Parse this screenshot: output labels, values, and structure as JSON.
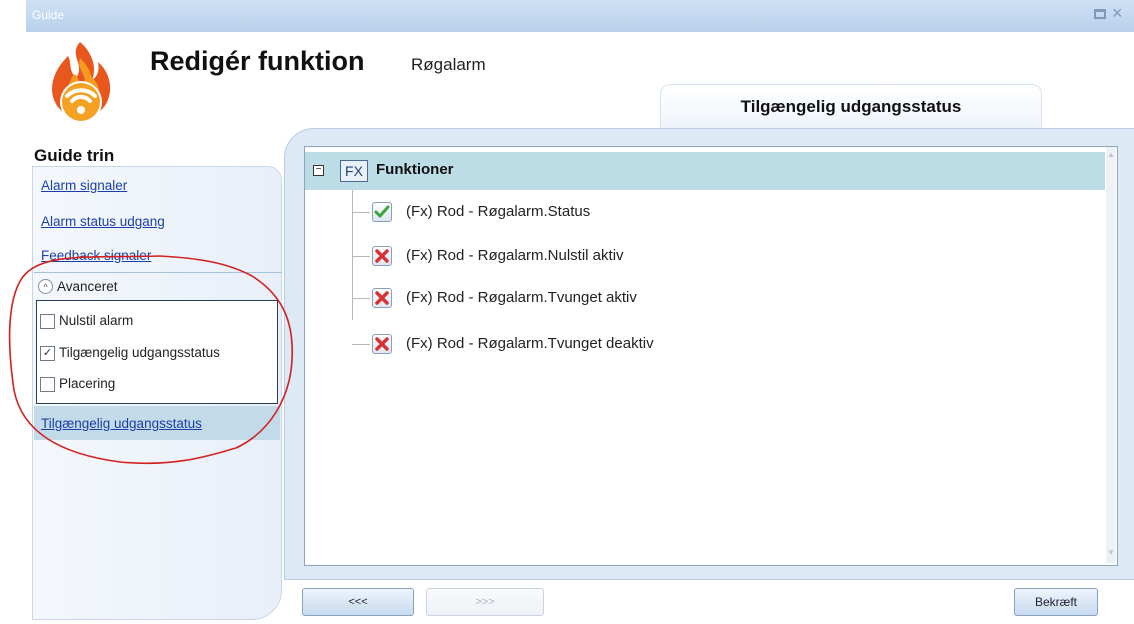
{
  "window": {
    "title": "Guide",
    "maximize_icon": "maximize-icon",
    "close_icon": "close-icon",
    "titlebar_color": "#b9d1ec"
  },
  "header": {
    "title": "Redigér funktion",
    "subtitle": "Røgalarm",
    "logo_icon": "smoke-alarm-flame-icon"
  },
  "tab": {
    "label": "Tilgængelig udgangsstatus"
  },
  "sidebar": {
    "heading": "Guide trin",
    "links": [
      "Alarm signaler",
      "Alarm status udgang",
      "Feedback signaler"
    ],
    "advanced": {
      "label": "Avanceret",
      "options": [
        {
          "label": "Nulstil alarm",
          "checked": false
        },
        {
          "label": "Tilgængelig udgangsstatus",
          "checked": true
        },
        {
          "label": "Placering",
          "checked": false
        }
      ]
    },
    "selected_link": "Tilgængelig udgangsstatus"
  },
  "tree": {
    "root_label": "Funktioner",
    "root_icon_text": "FX",
    "expand_symbol": "−",
    "items": [
      {
        "label": "(Fx) Rod - Røgalarm.Status",
        "status": "check-icon"
      },
      {
        "label": "(Fx) Rod - Røgalarm.Nulstil aktiv",
        "status": "cross-icon"
      },
      {
        "label": "(Fx) Rod - Røgalarm.Tvunget aktiv",
        "status": "cross-icon"
      },
      {
        "label": "(Fx) Rod - Røgalarm.Tvunget deaktiv",
        "status": "cross-icon"
      }
    ],
    "header_color": "#bcdce6"
  },
  "buttons": {
    "prev": "<<<",
    "next": ">>>",
    "confirm": "Bekræft"
  },
  "colors": {
    "link": "#1a3fa6",
    "annotation": "#d42020",
    "check": "#3aa53a",
    "cross": "#d63434"
  }
}
